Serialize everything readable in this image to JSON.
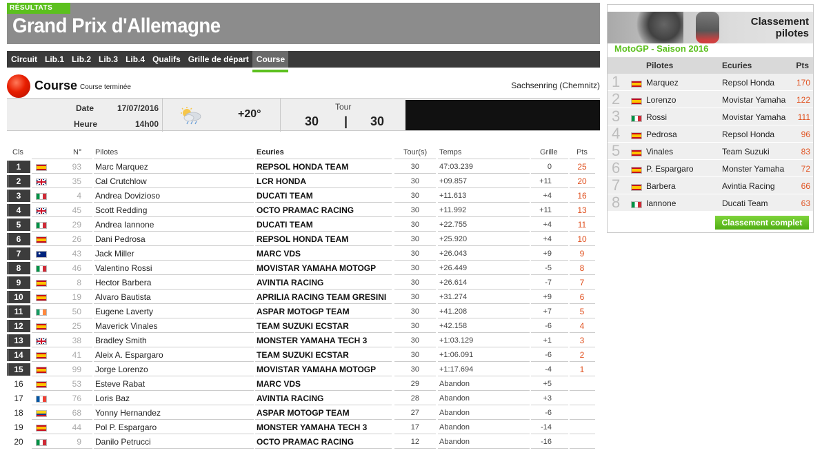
{
  "header": {
    "tag": "RÉSULTATS",
    "title": "Grand Prix d'Allemagne"
  },
  "nav": {
    "tabs": [
      "Circuit",
      "Lib.1",
      "Lib.2",
      "Lib.3",
      "Lib.4",
      "Qualifs",
      "Grille de départ",
      "Course"
    ],
    "active": "Course"
  },
  "race": {
    "title": "Course",
    "status": "Course terminée",
    "circuit": "Sachsenring (Chemnitz)"
  },
  "info": {
    "date_label": "Date",
    "date_value": "17/07/2016",
    "time_label": "Heure",
    "time_value": "14h00",
    "weather_icon": "partly-cloudy-rain-icon",
    "temperature": "+20°",
    "tour_label": "Tour",
    "tour_current": "30",
    "tour_separator": "|",
    "tour_total": "30"
  },
  "table": {
    "headers": {
      "cls": "Cls",
      "num": "N°",
      "pilot": "Pilotes",
      "team": "Ecuries",
      "laps": "Tour(s)",
      "time": "Temps",
      "grid": "Grille",
      "pts": "Pts"
    },
    "rows": [
      {
        "pos": "1",
        "flag": "es",
        "num": "93",
        "pilot": "Marc Marquez",
        "team": "REPSOL HONDA TEAM",
        "laps": "30",
        "time": "47:03.239",
        "grid": "0",
        "pts": "25"
      },
      {
        "pos": "2",
        "flag": "gb",
        "num": "35",
        "pilot": "Cal Crutchlow",
        "team": "LCR HONDA",
        "laps": "30",
        "time": "+09.857",
        "grid": "+11",
        "pts": "20"
      },
      {
        "pos": "3",
        "flag": "it",
        "num": "4",
        "pilot": "Andrea Dovizioso",
        "team": "DUCATI TEAM",
        "laps": "30",
        "time": "+11.613",
        "grid": "+4",
        "pts": "16"
      },
      {
        "pos": "4",
        "flag": "gb",
        "num": "45",
        "pilot": "Scott Redding",
        "team": "OCTO PRAMAC RACING",
        "laps": "30",
        "time": "+11.992",
        "grid": "+11",
        "pts": "13"
      },
      {
        "pos": "5",
        "flag": "it",
        "num": "29",
        "pilot": "Andrea Iannone",
        "team": "DUCATI TEAM",
        "laps": "30",
        "time": "+22.755",
        "grid": "+4",
        "pts": "11"
      },
      {
        "pos": "6",
        "flag": "es",
        "num": "26",
        "pilot": "Dani Pedrosa",
        "team": "REPSOL HONDA TEAM",
        "laps": "30",
        "time": "+25.920",
        "grid": "+4",
        "pts": "10"
      },
      {
        "pos": "7",
        "flag": "au",
        "num": "43",
        "pilot": "Jack Miller",
        "team": "MARC VDS",
        "laps": "30",
        "time": "+26.043",
        "grid": "+9",
        "pts": "9"
      },
      {
        "pos": "8",
        "flag": "it",
        "num": "46",
        "pilot": "Valentino Rossi",
        "team": "MOVISTAR YAMAHA MOTOGP",
        "laps": "30",
        "time": "+26.449",
        "grid": "-5",
        "pts": "8"
      },
      {
        "pos": "9",
        "flag": "es",
        "num": "8",
        "pilot": "Hector Barbera",
        "team": "AVINTIA RACING",
        "laps": "30",
        "time": "+26.614",
        "grid": "-7",
        "pts": "7"
      },
      {
        "pos": "10",
        "flag": "es",
        "num": "19",
        "pilot": "Alvaro Bautista",
        "team": "APRILIA RACING TEAM GRESINI",
        "laps": "30",
        "time": "+31.274",
        "grid": "+9",
        "pts": "6"
      },
      {
        "pos": "11",
        "flag": "ie",
        "num": "50",
        "pilot": "Eugene Laverty",
        "team": "ASPAR MOTOGP TEAM",
        "laps": "30",
        "time": "+41.208",
        "grid": "+7",
        "pts": "5"
      },
      {
        "pos": "12",
        "flag": "es",
        "num": "25",
        "pilot": "Maverick Vinales",
        "team": "TEAM SUZUKI ECSTAR",
        "laps": "30",
        "time": "+42.158",
        "grid": "-6",
        "pts": "4"
      },
      {
        "pos": "13",
        "flag": "gb",
        "num": "38",
        "pilot": "Bradley Smith",
        "team": "MONSTER YAMAHA TECH 3",
        "laps": "30",
        "time": "+1:03.129",
        "grid": "+1",
        "pts": "3"
      },
      {
        "pos": "14",
        "flag": "es",
        "num": "41",
        "pilot": "Aleix A. Espargaro",
        "team": "TEAM SUZUKI ECSTAR",
        "laps": "30",
        "time": "+1:06.091",
        "grid": "-6",
        "pts": "2"
      },
      {
        "pos": "15",
        "flag": "es",
        "num": "99",
        "pilot": "Jorge Lorenzo",
        "team": "MOVISTAR YAMAHA MOTOGP",
        "laps": "30",
        "time": "+1:17.694",
        "grid": "-4",
        "pts": "1"
      },
      {
        "pos": "16",
        "flag": "es",
        "num": "53",
        "pilot": "Esteve Rabat",
        "team": "MARC VDS",
        "laps": "29",
        "time": "Abandon",
        "grid": "+5",
        "pts": ""
      },
      {
        "pos": "17",
        "flag": "fr",
        "num": "76",
        "pilot": "Loris Baz",
        "team": "AVINTIA RACING",
        "laps": "28",
        "time": "Abandon",
        "grid": "+3",
        "pts": ""
      },
      {
        "pos": "18",
        "flag": "co",
        "num": "68",
        "pilot": "Yonny Hernandez",
        "team": "ASPAR MOTOGP TEAM",
        "laps": "27",
        "time": "Abandon",
        "grid": "-6",
        "pts": ""
      },
      {
        "pos": "19",
        "flag": "es",
        "num": "44",
        "pilot": "Pol P. Espargaro",
        "team": "MONSTER YAMAHA TECH 3",
        "laps": "17",
        "time": "Abandon",
        "grid": "-14",
        "pts": ""
      },
      {
        "pos": "20",
        "flag": "it",
        "num": "9",
        "pilot": "Danilo Petrucci",
        "team": "OCTO PRAMAC RACING",
        "laps": "12",
        "time": "Abandon",
        "grid": "-16",
        "pts": ""
      }
    ]
  },
  "standings": {
    "title_line1": "Classement",
    "title_line2": "pilotes",
    "season": "MotoGP - Saison 2016",
    "headers": {
      "pilot": "Pilotes",
      "team": "Ecuries",
      "pts": "Pts"
    },
    "rows": [
      {
        "rank": "1",
        "flag": "es",
        "pilot": "Marquez",
        "team": "Repsol Honda",
        "pts": "170"
      },
      {
        "rank": "2",
        "flag": "es",
        "pilot": "Lorenzo",
        "team": "Movistar Yamaha",
        "pts": "122"
      },
      {
        "rank": "3",
        "flag": "it",
        "pilot": "Rossi",
        "team": "Movistar Yamaha",
        "pts": "111"
      },
      {
        "rank": "4",
        "flag": "es",
        "pilot": "Pedrosa",
        "team": "Repsol Honda",
        "pts": "96"
      },
      {
        "rank": "5",
        "flag": "es",
        "pilot": "Vinales",
        "team": "Team Suzuki",
        "pts": "83"
      },
      {
        "rank": "6",
        "flag": "es",
        "pilot": "P. Espargaro",
        "team": "Monster Yamaha",
        "pts": "72"
      },
      {
        "rank": "7",
        "flag": "es",
        "pilot": "Barbera",
        "team": "Avintia Racing",
        "pts": "66"
      },
      {
        "rank": "8",
        "flag": "it",
        "pilot": "Iannone",
        "team": "Ducati Team",
        "pts": "63"
      }
    ],
    "button": "Classement complet"
  },
  "colors": {
    "accent_green": "#5cc01e",
    "banner_gray": "#8c8c8c",
    "nav_dark": "#3a3a3a",
    "points_orange": "#e0501e",
    "race_red": "#e81e00"
  }
}
